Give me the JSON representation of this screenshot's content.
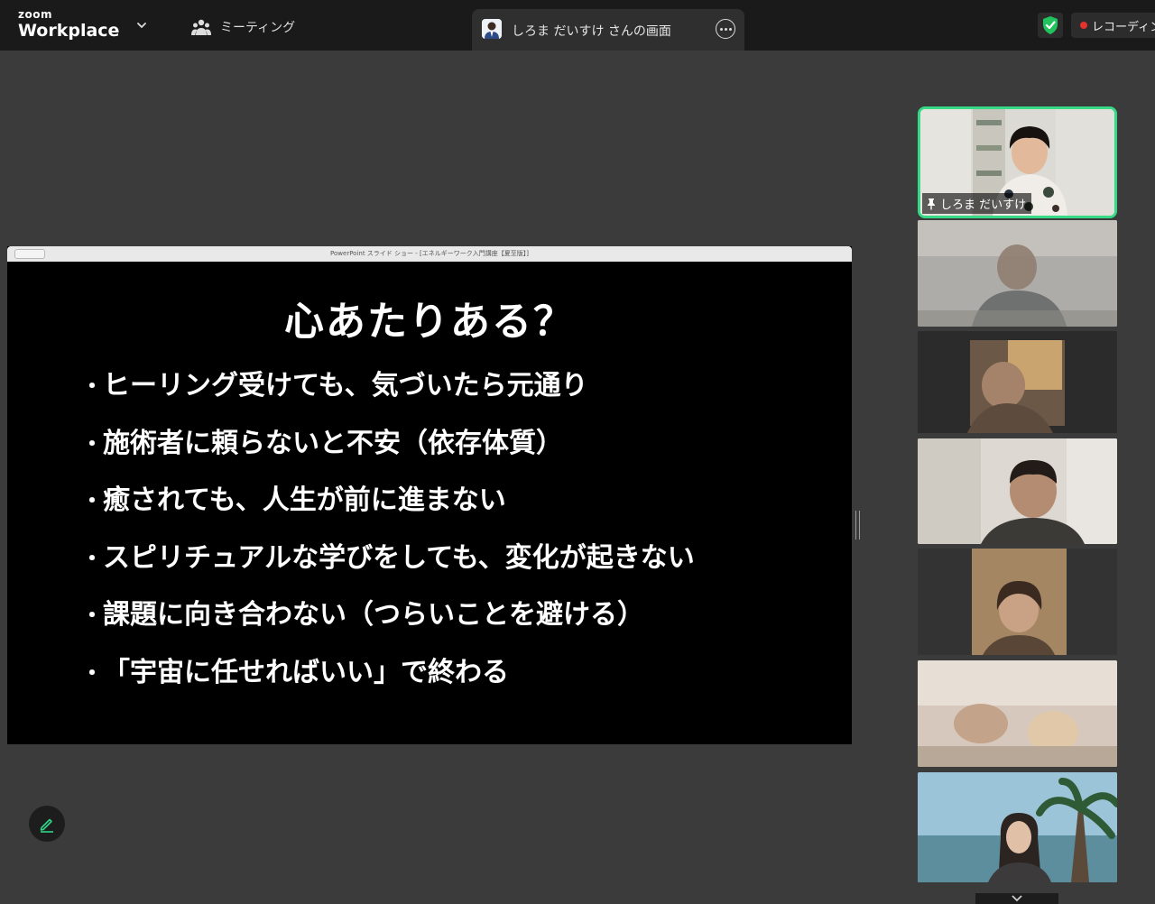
{
  "app": {
    "logo_small": "zoom",
    "logo_big": "Workplace"
  },
  "topbar": {
    "meeting_label": "ミーティング",
    "share_tab_label": "しろま だいすけ さんの画面",
    "recording_label": "レコーディング",
    "colors": {
      "bar_bg": "#1a1a1a",
      "shield_green": "#22c35e",
      "record_red": "#e5322d"
    }
  },
  "presentation": {
    "window_title": "PowerPoint スライド ショー - [エネルギーワーク入門講座【夏至版】]",
    "slide_title": "心あたりある？",
    "bullet_mark": "・",
    "bullets": [
      "ヒーリング受けても、気づいたら元通り",
      "施術者に頼らないと不安（依存体質）",
      "癒されても、人生が前に進まない",
      "スピリチュアルな学びをしても、変化が起きない",
      "課題に向き合わない（つらいことを避ける）",
      "「宇宙に任せればいい」で終わる"
    ]
  },
  "gallery": {
    "active_speaker_name": "しろま だいすけ",
    "active_border_color": "#35d986",
    "icons": [
      "pin-icon"
    ]
  }
}
